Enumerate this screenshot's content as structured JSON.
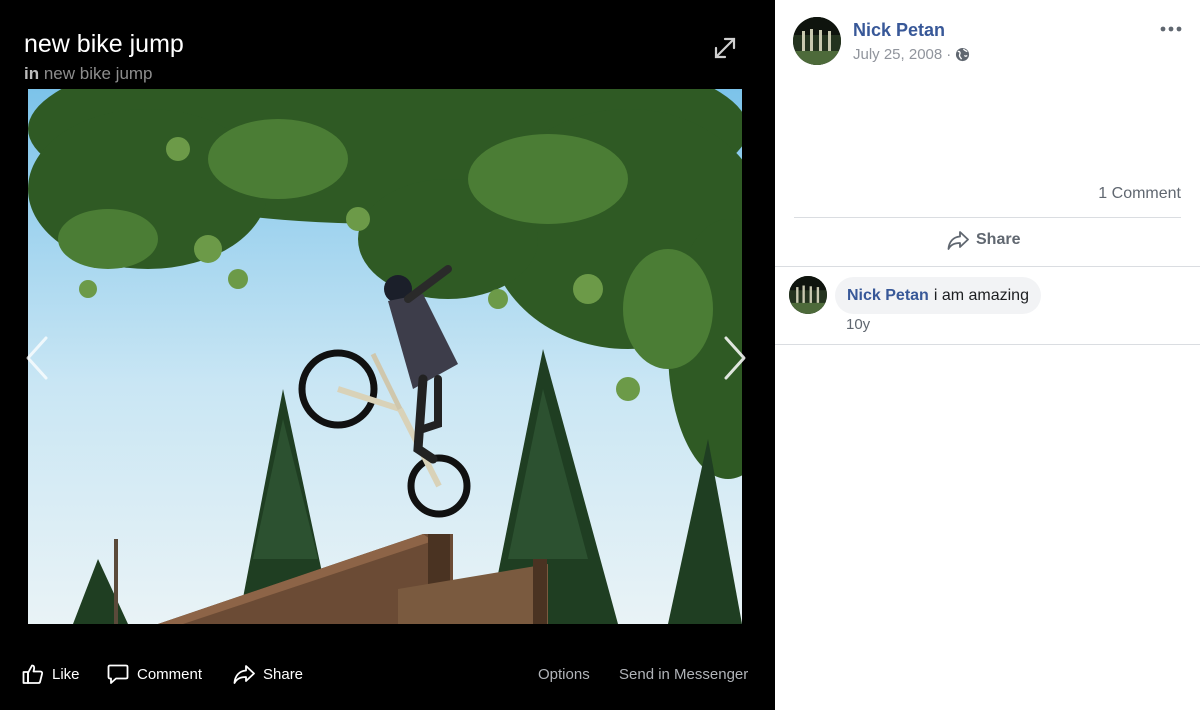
{
  "viewer": {
    "title": "new bike jump",
    "album_prefix": "in",
    "album_name": "new bike jump"
  },
  "actions": {
    "like": "Like",
    "comment": "Comment",
    "share": "Share",
    "options": "Options",
    "send": "Send in Messenger"
  },
  "post": {
    "author": "Nick Petan",
    "date": "July 25, 2008",
    "separator": "·",
    "privacy_icon": "globe-icon",
    "comment_count": "1 Comment",
    "share_label": "Share"
  },
  "comments": [
    {
      "author": "Nick Petan",
      "text": "i am amazing",
      "time": "10y"
    }
  ],
  "colors": {
    "link": "#385898",
    "viewer_bg": "#000000",
    "bubble_bg": "#f2f3f5"
  }
}
